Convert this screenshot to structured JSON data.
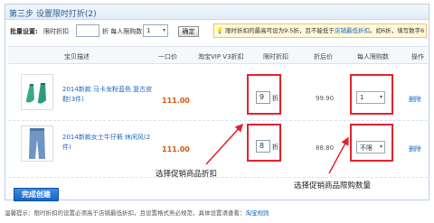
{
  "title": "第三步 设置限时打折(2)",
  "batch": {
    "label": "批量设置:",
    "discount_label": "限时折扣",
    "discount_value": "",
    "limit_label": "折 每人限购数",
    "limit_value": "1",
    "confirm_label": "确定"
  },
  "hint": {
    "text": "限时折扣的最高可设为9.5折，且不能低于",
    "link": "店铺最低折扣",
    "text2": "。如6折，填写数字6"
  },
  "columns": [
    "宝贝描述",
    "一口价",
    "淘宝VIP V3折扣",
    "限时折扣",
    "折后价",
    "每人限购数",
    "操作"
  ],
  "rows": [
    {
      "name": "2014新款 马卡龙粉蓝色 复古皮鞋(3件)",
      "price": "111.00",
      "discount": "9",
      "discount_unit": "折",
      "after_price": "99.90",
      "limit": "1",
      "action": "删除"
    },
    {
      "name": "2014新款女士牛仔裤 休闲风(2件)",
      "price": "111.00",
      "discount": "8",
      "discount_unit": "折",
      "after_price": "88.80",
      "limit": "不限",
      "action": "删除"
    }
  ],
  "annotations": {
    "discount": "选择促销商品折扣",
    "limit": "选择促销商品限购数量"
  },
  "submit_label": "完成创建",
  "footer": {
    "text": "温馨提示：限时折扣的设置必须高于店铺最低折扣，且设置格式务必规范，具体设置请查看：",
    "link": "淘宝规则"
  },
  "colors": {
    "accent": "#1566c7",
    "highlight": "#e0232e",
    "price": "#d9540f"
  }
}
